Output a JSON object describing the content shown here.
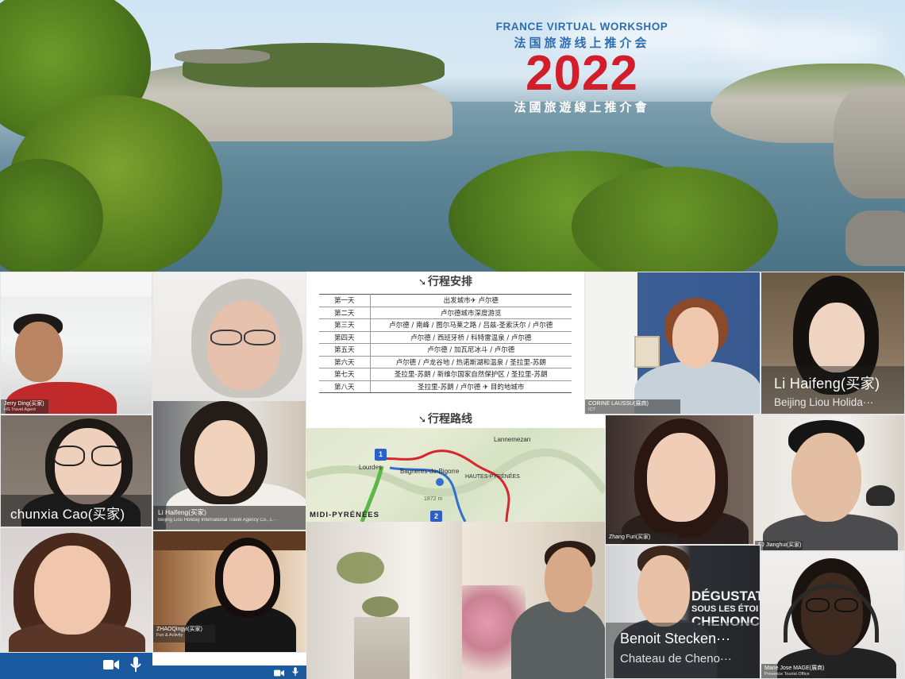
{
  "banner": {
    "title_en": "FRANCE VIRTUAL WORKSHOP",
    "title_cn_simplified": "法国旅游线上推介会",
    "year": "2022",
    "title_cn_traditional": "法國旅遊線上推介會"
  },
  "participants": [
    {
      "id": "p1",
      "name": "Jerry Ding(买家)",
      "subtitle": "HS Travel Agent"
    },
    {
      "id": "p2",
      "name": "",
      "subtitle": ""
    },
    {
      "id": "p3",
      "name": "CORINE LAUSSU(展商)",
      "subtitle": "ICT"
    },
    {
      "id": "p4",
      "name": "Li Haifeng(买家)",
      "subtitle": "Beijing Liou Holida···"
    },
    {
      "id": "p5",
      "name": "chunxia Cao(买家)",
      "subtitle": ""
    },
    {
      "id": "p6",
      "name": "Li Haifeng(买家)",
      "subtitle": "Beijing Liou Holiday International Travel Agency Co., L···"
    },
    {
      "id": "p7",
      "name": "Zhang Furi(买家)",
      "subtitle": ""
    },
    {
      "id": "p8",
      "name": "FJ Jianghui(买家)",
      "subtitle": ""
    },
    {
      "id": "p9",
      "name": "",
      "subtitle": ""
    },
    {
      "id": "p10",
      "name": "ZHAOQingyi(买家)",
      "subtitle": "Fun & Activity"
    },
    {
      "id": "p11",
      "name": "Benoit Stecken···",
      "subtitle": "Chateau de Cheno···"
    },
    {
      "id": "p12",
      "name": "Marie Jose MAGE(展商)",
      "subtitle": "Provence Tourist Office"
    }
  ],
  "slide": {
    "itinerary_heading": "行程安排",
    "route_heading": "行程路线",
    "itinerary": [
      {
        "day": "第一天",
        "route": "出发城市✈ 卢尔德"
      },
      {
        "day": "第二天",
        "route": "卢尔德城市深度游览"
      },
      {
        "day": "第三天",
        "route": "卢尔德 / 南峰 / 图尔马莱之路 / 吕兹-圣索沃尔 / 卢尔德"
      },
      {
        "day": "第四天",
        "route": "卢尔德 / 西班牙桥 / 科特雷温泉 / 卢尔德"
      },
      {
        "day": "第五天",
        "route": "卢尔德 / 加瓦尼冰斗 / 卢尔德"
      },
      {
        "day": "第六天",
        "route": "卢尔德 / 卢龙谷地 / 热诺斯湖和温泉 / 圣拉里-苏朗"
      },
      {
        "day": "第七天",
        "route": "圣拉里-苏朗 / 新维尔国家自然保护区 / 圣拉里-苏朗"
      },
      {
        "day": "第八天",
        "route": "圣拉里-苏朗 / 卢尔德 ✈ 目的地城市"
      }
    ]
  },
  "map": {
    "labels": {
      "lannemezan": "Lannemezan",
      "lourdes": "Lourdes",
      "bagneres": "Bagneres-de-Bigorre",
      "hautes": "HAUTES-PYRÉNÉES",
      "midi": "MIDI-PYRÉNÉES",
      "alt": "1872 m"
    },
    "markers": [
      "1",
      "2"
    ]
  },
  "sign": {
    "line1": "DÉGUSTAT",
    "line2": "SOUS LES ÉTOI",
    "line3": "CHENONC"
  },
  "colors": {
    "toolbar": "#1c5aa0",
    "title_blue": "#2f6db0",
    "title_red": "#d21d2b"
  },
  "icons": {
    "camera": "video-camera-icon",
    "mic": "microphone-icon"
  }
}
